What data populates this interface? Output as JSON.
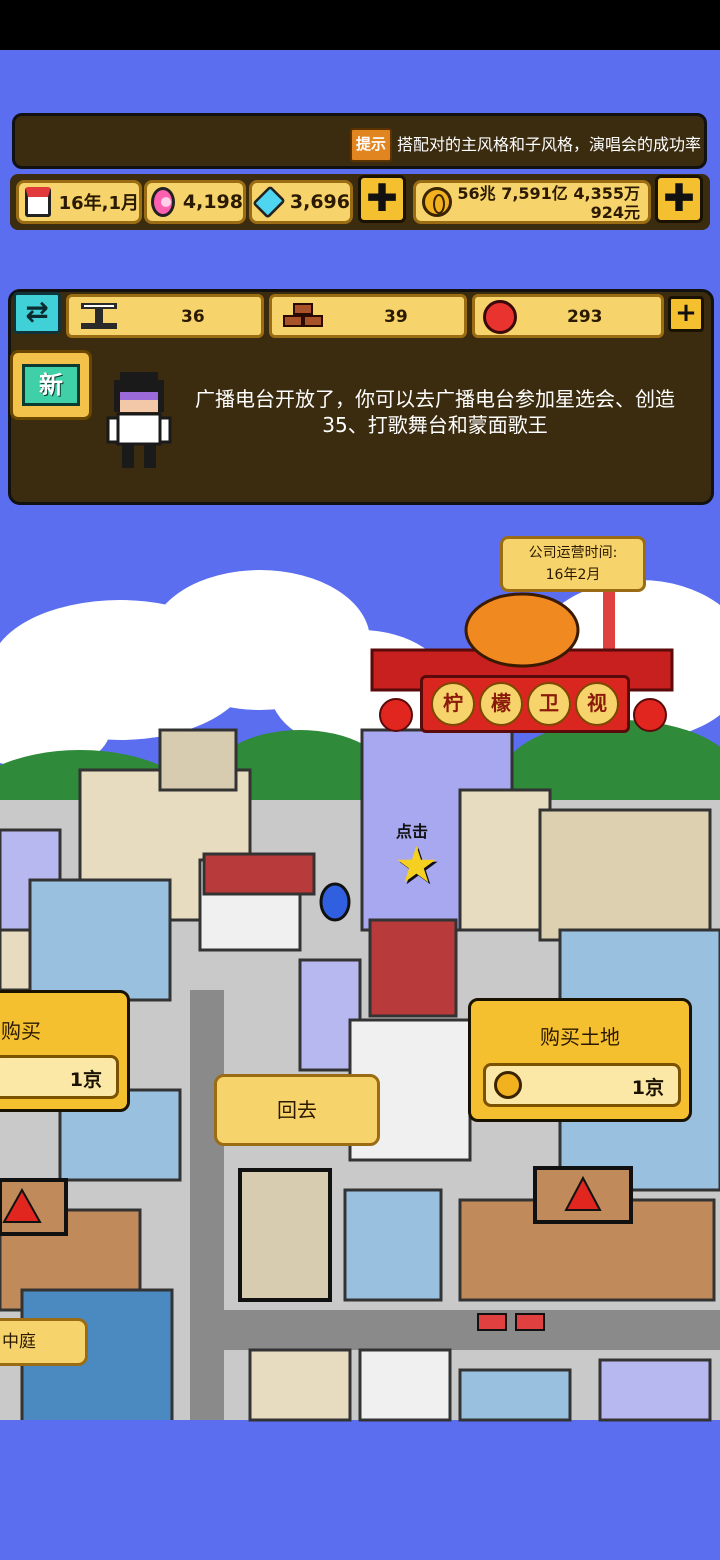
{
  "ticker": {
    "badge": "提示",
    "text": "搭配对的主风格和子风格，演唱会的成功率"
  },
  "resources": {
    "date": "16年,1月",
    "pink_gems": "4,198",
    "blue_gems": "3,696",
    "money_line1": "56兆 7,591亿 4,355万",
    "money_line2": "924元",
    "plus": "✚"
  },
  "stats": {
    "swap": "⇄",
    "steel": "36",
    "bricks": "39",
    "apples": "293",
    "plus": "+"
  },
  "notice": {
    "new_badge": "新",
    "message": "广播电台开放了，你可以去广播电台参加星选会、创造35、打歌舞台和蒙面歌王"
  },
  "city": {
    "ops_label": "公司运营时间:",
    "ops_value": "16年2月",
    "tv_chars": [
      "柠",
      "檬",
      "卫",
      "视"
    ],
    "tap_label": "点击",
    "star": "★",
    "buy_left_title": "购买",
    "buy_left_price": "1京",
    "buy_land_title": "购买土地",
    "buy_land_price": "1京",
    "return_label": "回去",
    "courtyard_label": "中庭"
  }
}
